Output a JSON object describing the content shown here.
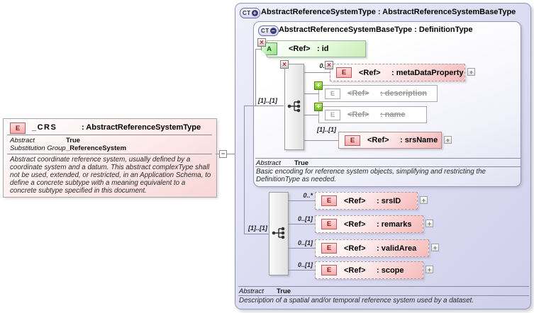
{
  "palette": {
    "accent-red": "#cc2222",
    "accent-green": "#76b421",
    "pink-fill": "#f5b8b8",
    "green-fill": "#cceebb",
    "lavender-top": "#f1f1fb",
    "lavender-bottom": "#cfcfeb",
    "box-border": "#999999"
  },
  "left_element": {
    "icon": "E",
    "name": "_CRS",
    "type": ": AbstractReferenceSystemType",
    "facts": [
      {
        "label": "Abstract",
        "value": "True"
      },
      {
        "label": "Substitution Group",
        "value": "_ReferenceSystem"
      }
    ],
    "description": "Abstract coordinate reference system, usually defined by a coordinate system and a datum. This abstract complexType shall not be used, extended, or restricted, in an Application Schema, to define a concrete subtype with a meaning equivalent to a concrete subtype specified in this document."
  },
  "connector": {
    "toggle": "−"
  },
  "outer": {
    "badge_text": "CT",
    "badge_sign": "+",
    "title": "AbstractReferenceSystemType : AbstractReferenceSystemBaseType",
    "footer_label": "Abstract",
    "footer_value": "True",
    "footer_description": "Description of a spatial and/or temporal reference system used by a dataset."
  },
  "inner": {
    "badge_text": "CT",
    "badge_sign": "−",
    "title": "AbstractReferenceSystemBaseType : DefinitionType",
    "attribute": {
      "badge": "×",
      "icon": "A",
      "ref": "<Ref>",
      "name": ": id"
    },
    "seq1_cardinality": "[1]..[1]",
    "seq1_badge": "×",
    "children": [
      {
        "cardinality": "0..*",
        "badge": "×",
        "icon": "E",
        "ref": "<Ref>",
        "name": ": metaDataProperty",
        "expand": "+"
      },
      {
        "badge": "+",
        "icon": "E",
        "ref": "<Ref>",
        "name": ": description"
      },
      {
        "badge": "+",
        "icon": "E",
        "ref": "<Ref>",
        "name": ": name"
      },
      {
        "cardinality": "[1]..[1]",
        "icon": "E",
        "ref": "<Ref>",
        "name": ": srsName",
        "expand": "+"
      }
    ],
    "footer_label": "Abstract",
    "footer_value": "True",
    "footer_description": "Basic encoding for reference system objects, simplifying and restricting the DefinitionType as needed."
  },
  "seq2": {
    "cardinality": "[1]..[1]",
    "children": [
      {
        "cardinality": "0..*",
        "icon": "E",
        "ref": "<Ref>",
        "name": ": srsID",
        "expand": "+"
      },
      {
        "cardinality": "0..[1]",
        "icon": "E",
        "ref": "<Ref>",
        "name": ": remarks",
        "expand": "+"
      },
      {
        "cardinality": "0..[1]",
        "icon": "E",
        "ref": "<Ref>",
        "name": ": validArea",
        "expand": "+"
      },
      {
        "cardinality": "0..[1]",
        "icon": "E",
        "ref": "<Ref>",
        "name": ": scope",
        "expand": "+"
      }
    ]
  }
}
